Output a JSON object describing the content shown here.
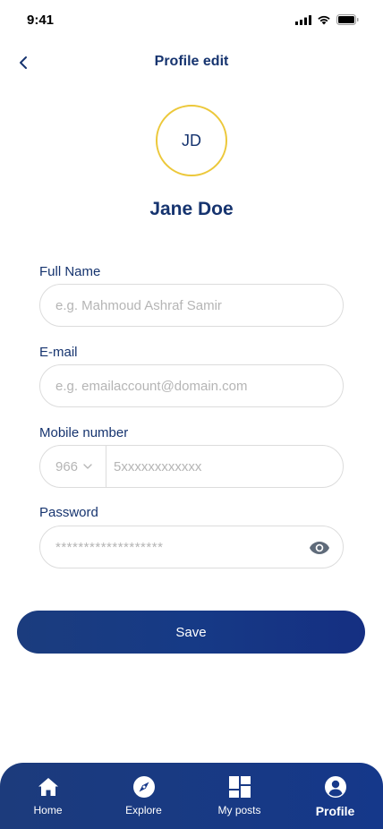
{
  "status_bar": {
    "time": "9:41"
  },
  "header": {
    "title": "Profile edit",
    "back_icon": "chevron-left-icon"
  },
  "profile": {
    "initials": "JD",
    "name": "Jane Doe",
    "avatar_border_color": "#ecc83a"
  },
  "form": {
    "full_name": {
      "label": "Full Name",
      "placeholder": "e.g. Mahmoud Ashraf Samir",
      "value": ""
    },
    "email": {
      "label": "E-mail",
      "placeholder": "e.g. emailaccount@domain.com",
      "value": ""
    },
    "mobile": {
      "label": "Mobile number",
      "country_code": "966",
      "placeholder": "5xxxxxxxxxxxx",
      "value": ""
    },
    "password": {
      "label": "Password",
      "placeholder": "*******************",
      "value": "",
      "toggle_icon": "eye-icon"
    }
  },
  "save_button": {
    "label": "Save"
  },
  "bottom_nav": {
    "items": [
      {
        "label": "Home",
        "icon": "home-icon",
        "active": false
      },
      {
        "label": "Explore",
        "icon": "compass-icon",
        "active": false
      },
      {
        "label": "My posts",
        "icon": "grid-icon",
        "active": false
      },
      {
        "label": "Profile",
        "icon": "user-circle-icon",
        "active": true
      }
    ]
  },
  "colors": {
    "primary": "#16346f",
    "accent": "#ecc83a",
    "input_border": "#dcdcdc",
    "placeholder": "#b5b5b5"
  }
}
